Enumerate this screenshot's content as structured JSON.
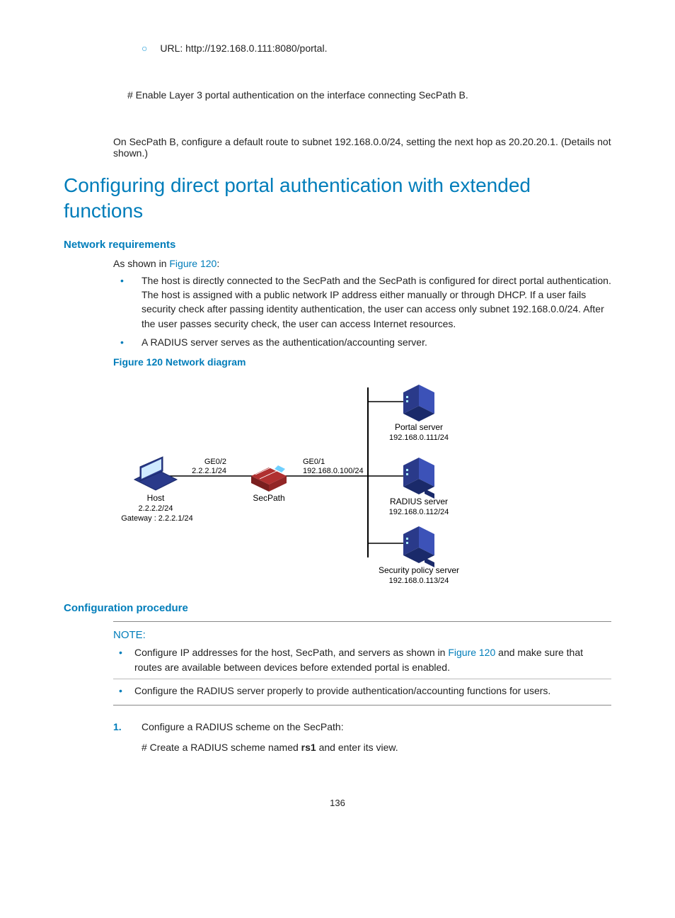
{
  "top": {
    "url_label": "URL: http://192.168.0.111:8080/portal.",
    "hash_line": "# Enable Layer 3 portal authentication on the interface connecting SecPath B.",
    "para": "On SecPath B, configure a default route to subnet 192.168.0.0/24, setting the next hop as 20.20.20.1. (Details not shown.)"
  },
  "h1": "Configuring direct portal authentication with extended functions",
  "section1": {
    "title": "Network requirements",
    "intro_prefix": "As shown in ",
    "intro_link": "Figure 120",
    "intro_suffix": ":",
    "bullets": [
      "The host is directly connected to the SecPath and the SecPath is configured for direct portal authentication. The host is assigned with a public network IP address either manually or through DHCP. If a user fails security check after passing identity authentication, the user can access only subnet 192.168.0.0/24. After the user passes security check, the user can access Internet resources.",
      "A RADIUS server serves as the authentication/accounting server."
    ],
    "figure_caption": "Figure 120 Network diagram"
  },
  "diagram": {
    "host": {
      "label": "Host",
      "ip": "2.2.2.2/24",
      "gateway": "Gateway : 2.2.2.1/24"
    },
    "secpath": {
      "label": "SecPath",
      "if_left": "GE0/2",
      "ip_left": "2.2.2.1/24",
      "if_right": "GE0/1",
      "ip_right": "192.168.0.100/24"
    },
    "portal": {
      "label": "Portal server",
      "ip": "192.168.0.111/24"
    },
    "radius": {
      "label": "RADIUS server",
      "ip": "192.168.0.112/24"
    },
    "security": {
      "label": "Security policy server",
      "ip": "192.168.0.113/24"
    }
  },
  "section2": {
    "title": "Configuration procedure",
    "note_label": "NOTE:",
    "note_items": [
      {
        "prefix": "Configure IP addresses for the host, SecPath, and servers as shown in ",
        "link": "Figure 120",
        "suffix": " and make sure that routes are available between devices before extended portal is enabled."
      },
      {
        "prefix": "Configure the RADIUS server properly to provide authentication/accounting functions for users.",
        "link": "",
        "suffix": ""
      }
    ],
    "steps": [
      {
        "num": "1.",
        "text": "Configure a RADIUS scheme on the SecPath:",
        "sub_prefix": "# Create a RADIUS scheme named ",
        "sub_bold": "rs1",
        "sub_suffix": " and enter its view."
      }
    ]
  },
  "page_number": "136"
}
